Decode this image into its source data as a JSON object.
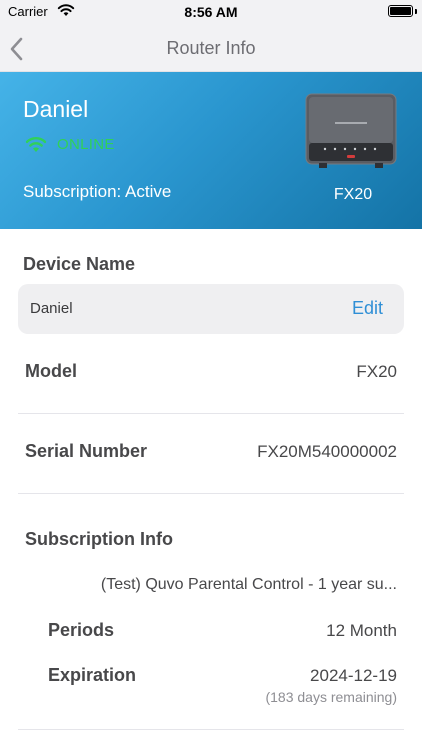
{
  "status_bar": {
    "carrier": "Carrier",
    "time": "8:56 AM"
  },
  "nav": {
    "title": "Router Info"
  },
  "header": {
    "name": "Daniel",
    "status": "ONLINE",
    "subscription": "Subscription: Active",
    "model": "FX20",
    "colors": {
      "gradient_start": "#45b3e8",
      "gradient_end": "#1473a6",
      "online": "#30d158"
    }
  },
  "device_name": {
    "label": "Device Name",
    "value": "Daniel",
    "edit_label": "Edit"
  },
  "model": {
    "label": "Model",
    "value": "FX20"
  },
  "serial": {
    "label": "Serial Number",
    "value": "FX20M540000002"
  },
  "subscription_info": {
    "label": "Subscription Info",
    "plan": "(Test) Quvo Parental Control - 1 year su...",
    "periods_label": "Periods",
    "periods_value": "12 Month",
    "expiration_label": "Expiration",
    "expiration_value": "2024-12-19",
    "remaining": "(183 days remaining)"
  },
  "colors": {
    "accent": "#2f8fd6"
  }
}
